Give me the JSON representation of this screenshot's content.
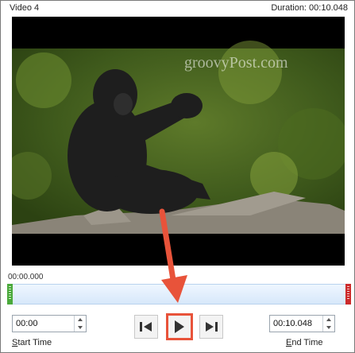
{
  "window": {
    "title": "Video 4",
    "duration": "Duration: 00:10.048"
  },
  "video": {
    "watermark": "groovyPost.com"
  },
  "playback": {
    "current_time": "00:00.000"
  },
  "trim": {
    "start_value": "00:00",
    "end_value": "00:10.048",
    "start_label_hotkey": "S",
    "start_label_rest": "tart Time",
    "end_label_hotkey": "E",
    "end_label_rest": "nd Time"
  },
  "colors": {
    "highlight": "#e8533a",
    "start_handle": "#4aa93b",
    "end_handle": "#cc2b2b"
  }
}
